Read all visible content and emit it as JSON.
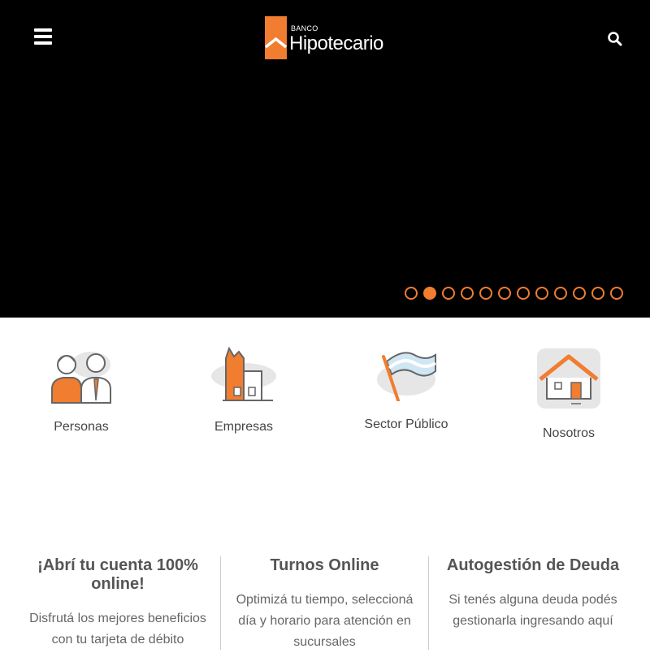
{
  "header": {
    "logo_small": "BANCO",
    "logo_name": "Hipotecario",
    "menu_icon": "hamburger-menu-icon",
    "search_icon": "search-icon"
  },
  "carousel": {
    "slide_count": 12,
    "active_index": 1,
    "accent_color": "#f07d30"
  },
  "categories": [
    {
      "label": "Personas",
      "icon": "people-icon"
    },
    {
      "label": "Empresas",
      "icon": "buildings-icon"
    },
    {
      "label": "Sector Público",
      "icon": "flag-icon"
    },
    {
      "label": "Nosotros",
      "icon": "house-icon"
    }
  ],
  "info": [
    {
      "title": "¡Abrí tu cuenta 100% online!",
      "text": [
        "Disfrutá los mejores beneficios",
        "con tu tarjeta de débito"
      ]
    },
    {
      "title": "Turnos Online",
      "text": [
        "Optimizá tu tiempo, seleccioná",
        "día y horario para atención en",
        "sucursales"
      ]
    },
    {
      "title": "Autogestión de Deuda",
      "text": [
        "Si tenés alguna deuda podés",
        "gestionarla ingresando aquí"
      ]
    }
  ]
}
